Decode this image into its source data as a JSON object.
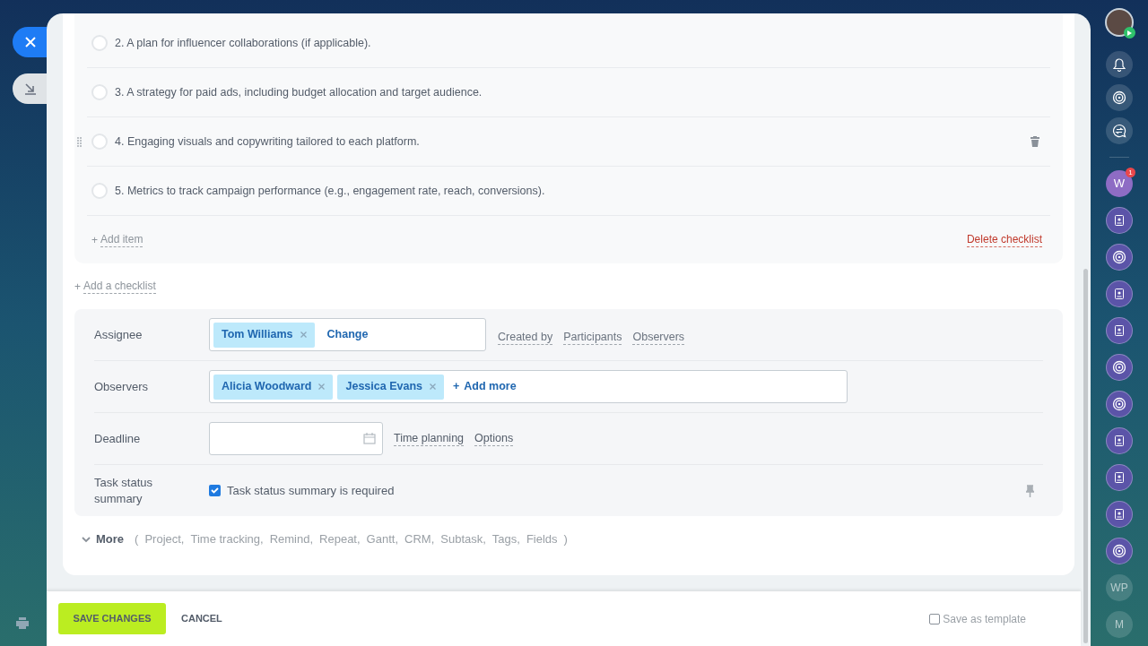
{
  "checklist": {
    "items": [
      {
        "number": "2.",
        "text": "A plan for influencer collaborations (if applicable).",
        "checked": false,
        "hovered": false
      },
      {
        "number": "3.",
        "text": "A strategy for paid ads, including budget allocation and target audience.",
        "checked": false,
        "hovered": false
      },
      {
        "number": "4.",
        "text": "Engaging visuals and copywriting tailored to each platform.",
        "checked": false,
        "hovered": true
      },
      {
        "number": "5.",
        "text": "Metrics to track campaign performance (e.g., engagement rate, reach, conversions).",
        "checked": false,
        "hovered": false
      }
    ],
    "add_item": "Add item",
    "add_item_plus": "+",
    "delete": "Delete checklist"
  },
  "add_checklist": {
    "plus": "+",
    "label": "Add a checklist"
  },
  "assignee": {
    "label": "Assignee",
    "chips": [
      "Tom Williams"
    ],
    "action": "Change",
    "links": [
      "Created by",
      "Participants",
      "Observers"
    ]
  },
  "observers": {
    "label": "Observers",
    "chips": [
      "Alicia Woodward",
      "Jessica Evans"
    ],
    "action_plus": "+",
    "action": "Add more"
  },
  "deadline": {
    "label": "Deadline",
    "links": [
      "Time planning",
      "Options"
    ]
  },
  "status_summary": {
    "label": "Task status summary",
    "checkbox_label": "Task status summary is required",
    "checked": true
  },
  "more": {
    "label": "More",
    "open_paren": "(",
    "items": [
      "Project,",
      "Time tracking,",
      "Remind,",
      "Repeat,",
      "Gantt,",
      "CRM,",
      "Subtask,",
      "Tags,",
      "Fields"
    ],
    "close_paren": ")"
  },
  "footer": {
    "save": "SAVE CHANGES",
    "cancel": "CANCEL",
    "template_label": "Save as template",
    "template_checked": false
  },
  "rail": [
    {
      "kind": "photo",
      "status": true
    },
    {
      "kind": "bell"
    },
    {
      "kind": "swirl"
    },
    {
      "kind": "chat"
    },
    {
      "kind": "divider"
    },
    {
      "kind": "letter",
      "label": "W",
      "badge": "1"
    },
    {
      "kind": "contact"
    },
    {
      "kind": "swirl-purple"
    },
    {
      "kind": "contact"
    },
    {
      "kind": "contact"
    },
    {
      "kind": "swirl-purple"
    },
    {
      "kind": "swirl-purple"
    },
    {
      "kind": "contact"
    },
    {
      "kind": "contact"
    },
    {
      "kind": "contact"
    },
    {
      "kind": "swirl-purple"
    },
    {
      "kind": "text",
      "label": "WP"
    },
    {
      "kind": "text",
      "label": "M"
    }
  ]
}
